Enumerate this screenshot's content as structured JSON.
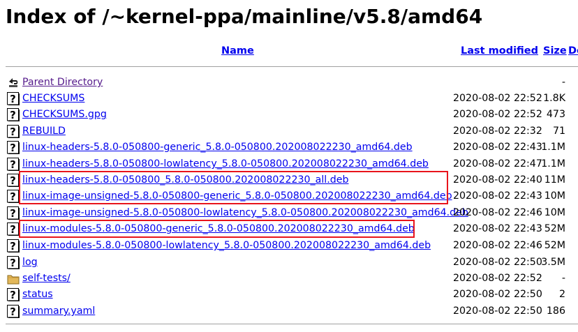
{
  "page": {
    "title": "Index of /~kernel-ppa/mainline/v5.8/amd64"
  },
  "columns": {
    "name": "Name",
    "last_modified": "Last modified",
    "size": "Size",
    "description": "De"
  },
  "entries": [
    {
      "name": "Parent Directory",
      "date": "",
      "size": "-",
      "icon": "back-icon"
    },
    {
      "name": "CHECKSUMS",
      "date": "2020-08-02 22:52",
      "size": "1.8K",
      "icon": "unknown-file-icon"
    },
    {
      "name": "CHECKSUMS.gpg",
      "date": "2020-08-02 22:52",
      "size": "473",
      "icon": "unknown-file-icon"
    },
    {
      "name": "REBUILD",
      "date": "2020-08-02 22:32",
      "size": "71",
      "icon": "unknown-file-icon"
    },
    {
      "name": "linux-headers-5.8.0-050800-generic_5.8.0-050800.202008022230_amd64.deb",
      "date": "2020-08-02 22:43",
      "size": "1.1M",
      "icon": "unknown-file-icon"
    },
    {
      "name": "linux-headers-5.8.0-050800-lowlatency_5.8.0-050800.202008022230_amd64.deb",
      "date": "2020-08-02 22:47",
      "size": "1.1M",
      "icon": "unknown-file-icon"
    },
    {
      "name": "linux-headers-5.8.0-050800_5.8.0-050800.202008022230_all.deb",
      "date": "2020-08-02 22:40",
      "size": "11M",
      "icon": "unknown-file-icon"
    },
    {
      "name": "linux-image-unsigned-5.8.0-050800-generic_5.8.0-050800.202008022230_amd64.deb",
      "date": "2020-08-02 22:43",
      "size": "10M",
      "icon": "unknown-file-icon"
    },
    {
      "name": "linux-image-unsigned-5.8.0-050800-lowlatency_5.8.0-050800.202008022230_amd64.deb",
      "date": "2020-08-02 22:46",
      "size": "10M",
      "icon": "unknown-file-icon"
    },
    {
      "name": "linux-modules-5.8.0-050800-generic_5.8.0-050800.202008022230_amd64.deb",
      "date": "2020-08-02 22:43",
      "size": "52M",
      "icon": "unknown-file-icon"
    },
    {
      "name": "linux-modules-5.8.0-050800-lowlatency_5.8.0-050800.202008022230_amd64.deb",
      "date": "2020-08-02 22:46",
      "size": "52M",
      "icon": "unknown-file-icon"
    },
    {
      "name": "log",
      "date": "2020-08-02 22:50",
      "size": "3.5M",
      "icon": "unknown-file-icon"
    },
    {
      "name": "self-tests/",
      "date": "2020-08-02 22:52",
      "size": "-",
      "icon": "folder-icon"
    },
    {
      "name": "status",
      "date": "2020-08-02 22:50",
      "size": "2",
      "icon": "unknown-file-icon"
    },
    {
      "name": "summary.yaml",
      "date": "2020-08-02 22:50",
      "size": "186",
      "icon": "unknown-file-icon"
    }
  ],
  "colors": {
    "link": "#0000ee",
    "visited_link": "#551a8b",
    "highlight_box": "#e8141c",
    "rule": "#a0a0a0"
  }
}
